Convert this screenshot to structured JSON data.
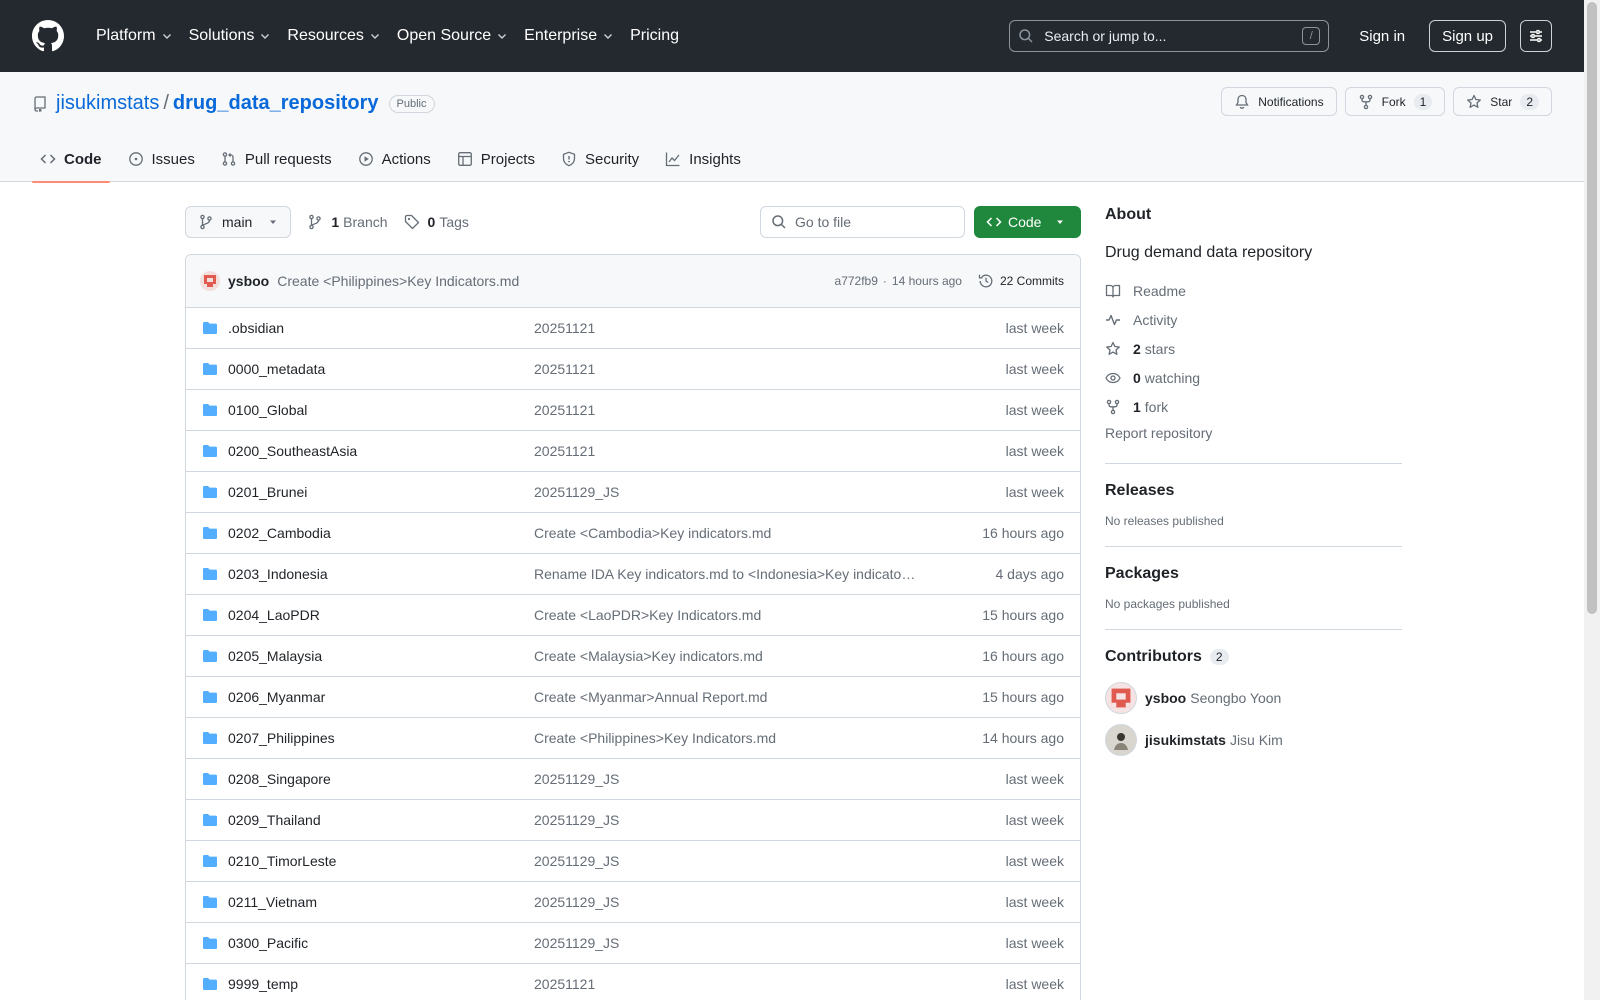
{
  "header": {
    "nav": [
      {
        "label": "Platform"
      },
      {
        "label": "Solutions"
      },
      {
        "label": "Resources"
      },
      {
        "label": "Open Source"
      },
      {
        "label": "Enterprise"
      },
      {
        "label": "Pricing"
      }
    ],
    "search_placeholder": "Search or jump to...",
    "search_key": "/",
    "sign_in": "Sign in",
    "sign_up": "Sign up"
  },
  "repo": {
    "owner": "jisukimstats",
    "separator": "/",
    "name": "drug_data_repository",
    "visibility": "Public",
    "notifications_label": "Notifications",
    "fork_label": "Fork",
    "fork_count": "1",
    "star_label": "Star",
    "star_count": "2",
    "tabs": [
      {
        "label": "Code"
      },
      {
        "label": "Issues"
      },
      {
        "label": "Pull requests"
      },
      {
        "label": "Actions"
      },
      {
        "label": "Projects"
      },
      {
        "label": "Security"
      },
      {
        "label": "Insights"
      }
    ]
  },
  "filebar": {
    "branch": "main",
    "branch_count": "1",
    "branch_label": "Branch",
    "tag_count": "0",
    "tag_label": "Tags",
    "goto_placeholder": "Go to file",
    "code_label": "Code"
  },
  "commit": {
    "author": "ysboo",
    "message": "Create <Philippines>Key Indicators.md",
    "hash": "a772fb9",
    "separator": "·",
    "time": "14 hours ago",
    "commits": "22 Commits"
  },
  "files": [
    {
      "name": ".obsidian",
      "message": "20251121",
      "time": "last week"
    },
    {
      "name": "0000_metadata",
      "message": "20251121",
      "time": "last week"
    },
    {
      "name": "0100_Global",
      "message": "20251121",
      "time": "last week"
    },
    {
      "name": "0200_SoutheastAsia",
      "message": "20251121",
      "time": "last week"
    },
    {
      "name": "0201_Brunei",
      "message": "20251129_JS",
      "time": "last week"
    },
    {
      "name": "0202_Cambodia",
      "message": "Create <Cambodia>Key indicators.md",
      "time": "16 hours ago"
    },
    {
      "name": "0203_Indonesia",
      "message": "Rename IDA Key indicators.md to <Indonesia>Key indicato…",
      "time": "4 days ago"
    },
    {
      "name": "0204_LaoPDR",
      "message": "Create <LaoPDR>Key Indicators.md",
      "time": "15 hours ago"
    },
    {
      "name": "0205_Malaysia",
      "message": "Create <Malaysia>Key indicators.md",
      "time": "16 hours ago"
    },
    {
      "name": "0206_Myanmar",
      "message": "Create <Myanmar>Annual Report.md",
      "time": "15 hours ago"
    },
    {
      "name": "0207_Philippines",
      "message": "Create <Philippines>Key Indicators.md",
      "time": "14 hours ago"
    },
    {
      "name": "0208_Singapore",
      "message": "20251129_JS",
      "time": "last week"
    },
    {
      "name": "0209_Thailand",
      "message": "20251129_JS",
      "time": "last week"
    },
    {
      "name": "0210_TimorLeste",
      "message": "20251129_JS",
      "time": "last week"
    },
    {
      "name": "0211_Vietnam",
      "message": "20251129_JS",
      "time": "last week"
    },
    {
      "name": "0300_Pacific",
      "message": "20251129_JS",
      "time": "last week"
    },
    {
      "name": "9999_temp",
      "message": "20251121",
      "time": "last week"
    }
  ],
  "sidebar": {
    "about_title": "About",
    "description": "Drug demand data repository",
    "readme": "Readme",
    "activity": "Activity",
    "stars_count": "2",
    "stars_label": "stars",
    "watching_count": "0",
    "watching_label": "watching",
    "fork_count": "1",
    "fork_label": "fork",
    "report": "Report repository",
    "releases_title": "Releases",
    "releases_note": "No releases published",
    "packages_title": "Packages",
    "packages_note": "No packages published",
    "contributors_title": "Contributors",
    "contributors_count": "2",
    "contributors": [
      {
        "user": "ysboo",
        "full": "Seongbo Yoon"
      },
      {
        "user": "jisukimstats",
        "full": "Jisu Kim"
      }
    ]
  },
  "colors": {
    "header_bg": "#24292f",
    "link": "#0969da",
    "folder": "#54aeff",
    "code_button": "#1f883d",
    "active_tab_underline": "#fd8c73"
  }
}
